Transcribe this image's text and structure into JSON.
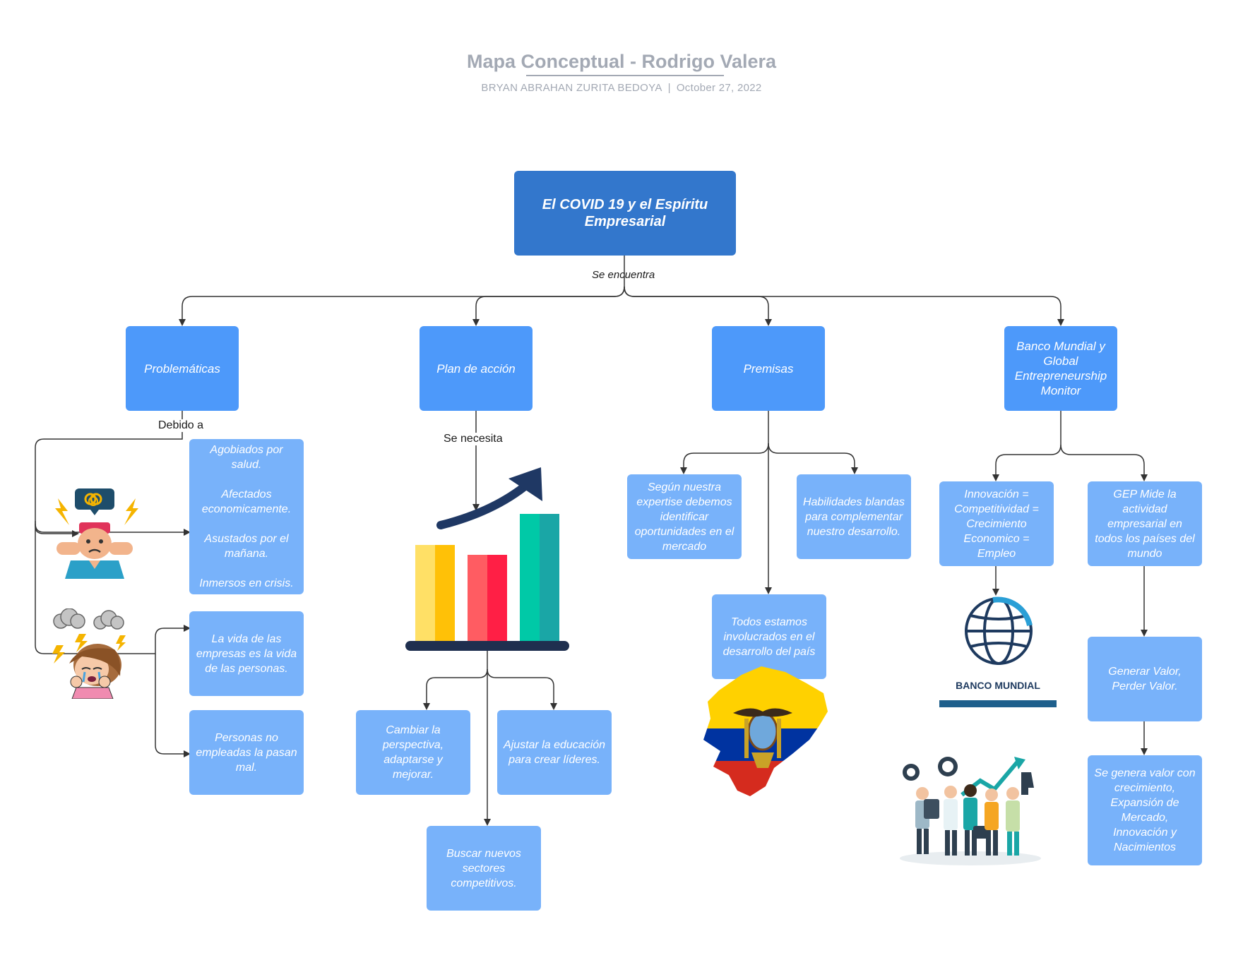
{
  "header": {
    "title": "Mapa Conceptual - Rodrigo Valera",
    "author": "BRYAN ABRAHAN ZURITA BEDOYA",
    "separator": "|",
    "date": "October 27, 2022"
  },
  "root": {
    "label": "El COVID 19 y el Espíritu Empresarial"
  },
  "connector_labels": {
    "root": "Se encuentra",
    "problematicas": "Debido a",
    "plan": "Se necesita"
  },
  "branches": {
    "problematicas": {
      "label": "Problemáticas",
      "items": [
        "Agobiados por salud.\n\nAfectados economicamente.\n\nAsustados por el mañana.\n\nInmersos en crisis.",
        "La vida de las empresas es la vida de las personas.",
        "Personas no empleadas la pasan mal."
      ]
    },
    "plan": {
      "label": "Plan de acción",
      "items": [
        "Cambiar la perspectiva, adaptarse y mejorar.",
        "Ajustar la educación para crear líderes.",
        "Buscar nuevos sectores competitivos."
      ]
    },
    "premisas": {
      "label": "Premisas",
      "items": [
        "Según nuestra expertise debemos identificar oportunidades en el mercado",
        "Habilidades blandas para complementar nuestro desarrollo.",
        "Todos estamos involucrados en el desarrollo del país"
      ]
    },
    "banco": {
      "label": "Banco Mundial y Global Entrepreneurship Monitor",
      "items": [
        "Innovación = Competitividad = Crecimiento Economico = Empleo",
        "GEP Mide la actividad empresarial en todos los países del mundo",
        "Generar Valor, Perder Valor.",
        "Se genera valor con crecimiento, Expansión de Mercado, Innovación y Nacimientos"
      ]
    }
  },
  "logos": {
    "world_bank": "BANCO MUNDIAL"
  },
  "icons": [
    "stressed-person-icon",
    "crying-person-icon",
    "growth-bar-chart-icon",
    "ecuador-map-icon",
    "world-bank-logo",
    "business-team-icon"
  ],
  "colors": {
    "root": "#3377cc",
    "level1": "#4d99fa",
    "level2": "#78b2fa",
    "connector": "#333333",
    "header": "#a3a9b4"
  }
}
